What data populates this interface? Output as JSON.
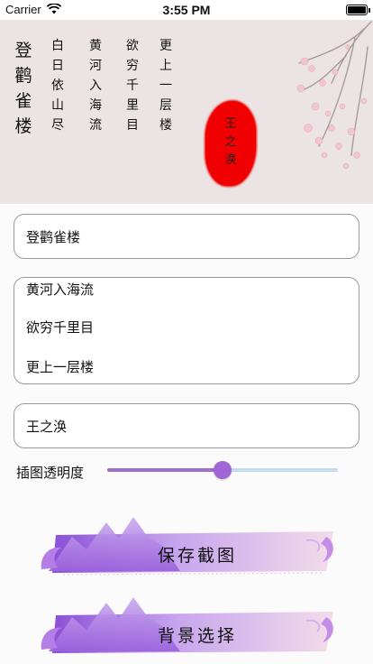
{
  "status_bar": {
    "carrier": "Carrier",
    "time": "3:55 PM",
    "battery_level": 1.0
  },
  "poem": {
    "title": [
      "登",
      "鹳",
      "雀",
      "楼"
    ],
    "lines": [
      [
        "白",
        "日",
        "依",
        "山",
        "尽"
      ],
      [
        "黄",
        "河",
        "入",
        "海",
        "流"
      ],
      [
        "欲",
        "穷",
        "千",
        "里",
        "目"
      ],
      [
        "更",
        "上",
        "一",
        "层",
        "楼"
      ]
    ],
    "seal": [
      "王",
      "之",
      "涣"
    ]
  },
  "form": {
    "title_value": "登鹳雀楼",
    "body_lines": [
      "黄河入海流",
      "欲穷千里目",
      "更上一层楼"
    ],
    "author_value": "王之涣",
    "opacity_label": "插图透明度",
    "opacity_value": 0.5
  },
  "buttons": {
    "save_label": "保存截图",
    "background_label": "背景选择"
  },
  "colors": {
    "accent": "#a066d6",
    "seal": "#f00000",
    "slider_track": "#c4dcf2",
    "panel_bg": "#ece4e4"
  }
}
